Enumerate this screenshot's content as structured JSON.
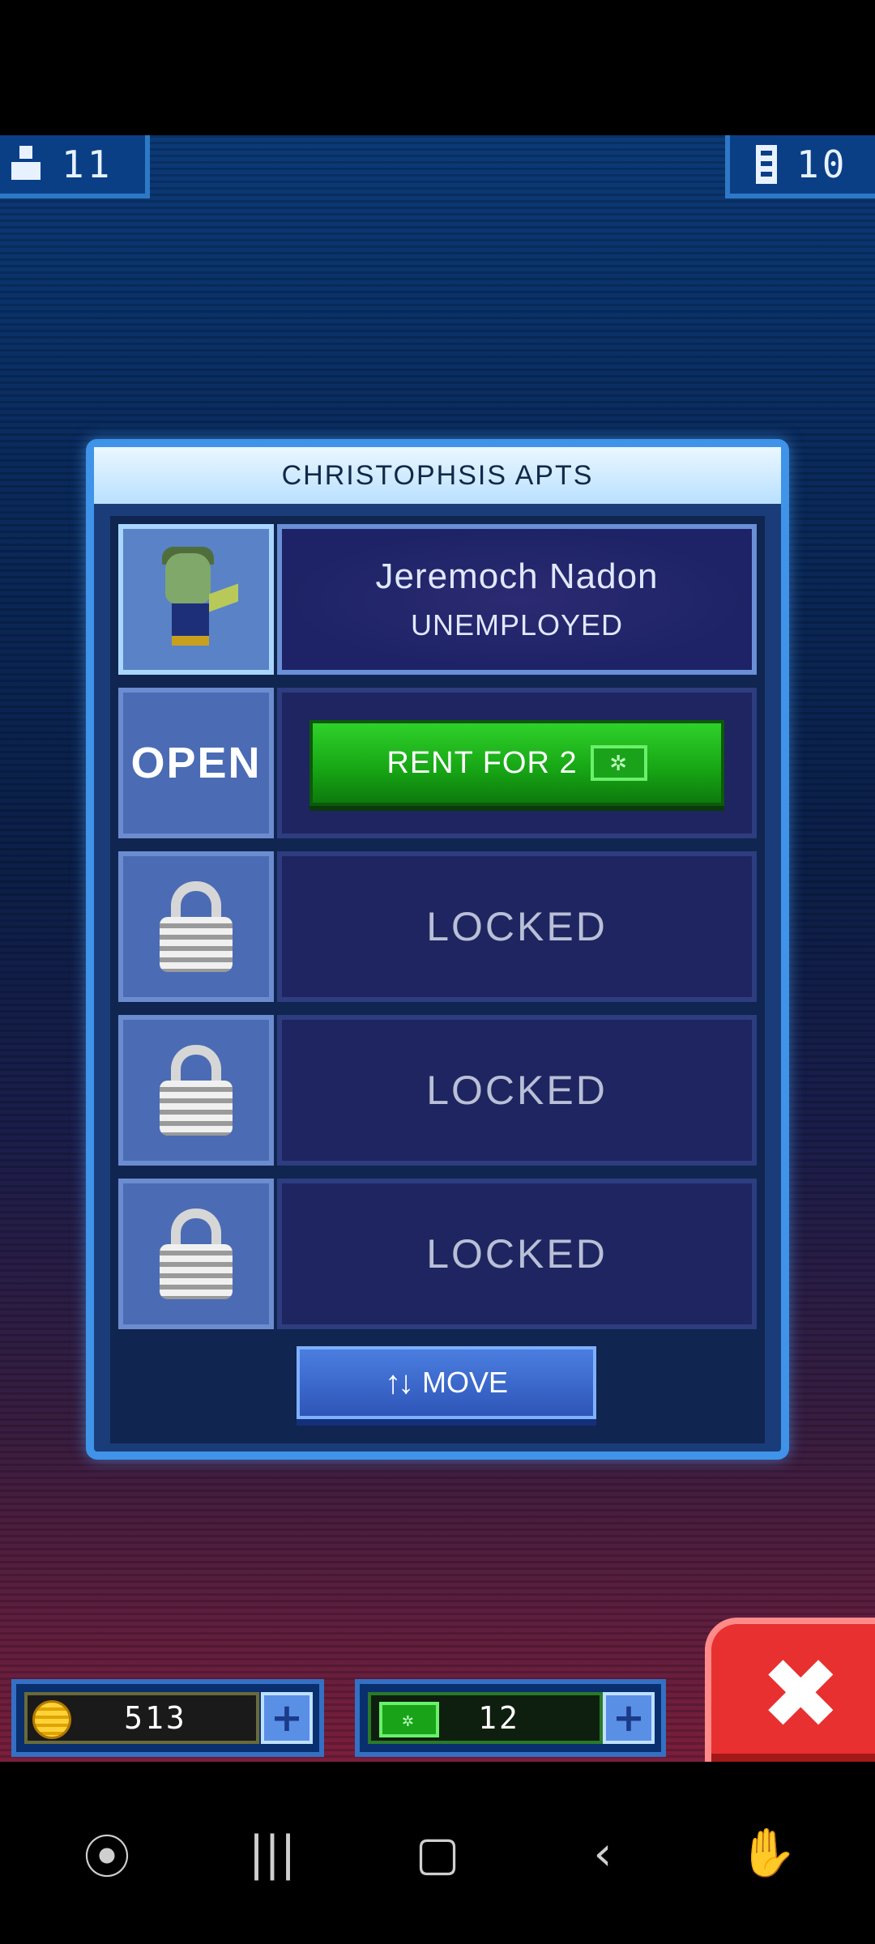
{
  "top_bar": {
    "residents_count": "11",
    "floors_count": "10"
  },
  "panel": {
    "title": "CHRISTOPHSIS APTS",
    "resident": {
      "name": "Jeremoch Nadon",
      "status": "UNEMPLOYED"
    },
    "open_row": {
      "label": "OPEN",
      "rent_button": "RENT FOR 2",
      "bux_symbol": "✲"
    },
    "locked_rows": [
      {
        "label": "LOCKED"
      },
      {
        "label": "LOCKED"
      },
      {
        "label": "LOCKED"
      }
    ],
    "move_button": {
      "arrows": "↑↓",
      "label": "MOVE"
    }
  },
  "currency": {
    "coins": "513",
    "bux": "12",
    "bux_symbol": "✲",
    "plus": "+"
  },
  "close_button": {
    "symbol": "✖"
  },
  "nav": {
    "game_icon": "⦿",
    "recents": "|||",
    "home": "▢",
    "back": "‹",
    "assist": "✋"
  },
  "colors": {
    "accent_blue": "#3f93e8",
    "rent_green": "#16a414",
    "close_red": "#e83030"
  }
}
